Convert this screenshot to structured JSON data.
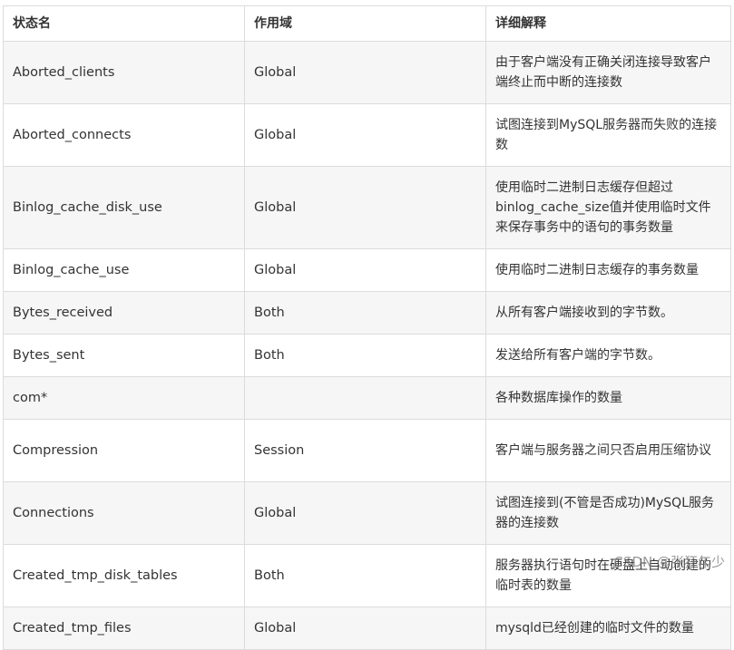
{
  "table": {
    "headers": [
      "状态名",
      "作用域",
      "详细解释"
    ],
    "rows": [
      {
        "name": "Aborted_clients",
        "scope": "Global",
        "desc": "由于客户端没有正确关闭连接导致客户端终止而中断的连接数"
      },
      {
        "name": "Aborted_connects",
        "scope": "Global",
        "desc": "试图连接到MySQL服务器而失败的连接数"
      },
      {
        "name": "Binlog_cache_disk_use",
        "scope": "Global",
        "desc": "使用临时二进制日志缓存但超过binlog_cache_size值并使用临时文件来保存事务中的语句的事务数量"
      },
      {
        "name": "Binlog_cache_use",
        "scope": "Global",
        "desc": "使用临时二进制日志缓存的事务数量"
      },
      {
        "name": "Bytes_received",
        "scope": "Both",
        "desc": "从所有客户端接收到的字节数。"
      },
      {
        "name": "Bytes_sent",
        "scope": "Both",
        "desc": "发送给所有客户端的字节数。"
      },
      {
        "name": "com*",
        "scope": "",
        "desc": "各种数据库操作的数量"
      },
      {
        "name": "Compression",
        "scope": "Session",
        "desc": "客户端与服务器之间只否启用压缩协议"
      },
      {
        "name": "Connections",
        "scope": "Global",
        "desc": "试图连接到(不管是否成功)MySQL服务器的连接数"
      },
      {
        "name": "Created_tmp_disk_tables",
        "scope": "Both",
        "desc": "服务器执行语句时在硬盘上自动创建的临时表的数量"
      },
      {
        "name": "Created_tmp_files",
        "scope": "Global",
        "desc": "mysqld已经创建的临时文件的数量"
      }
    ]
  },
  "watermark": "CSDN @张狂年少"
}
